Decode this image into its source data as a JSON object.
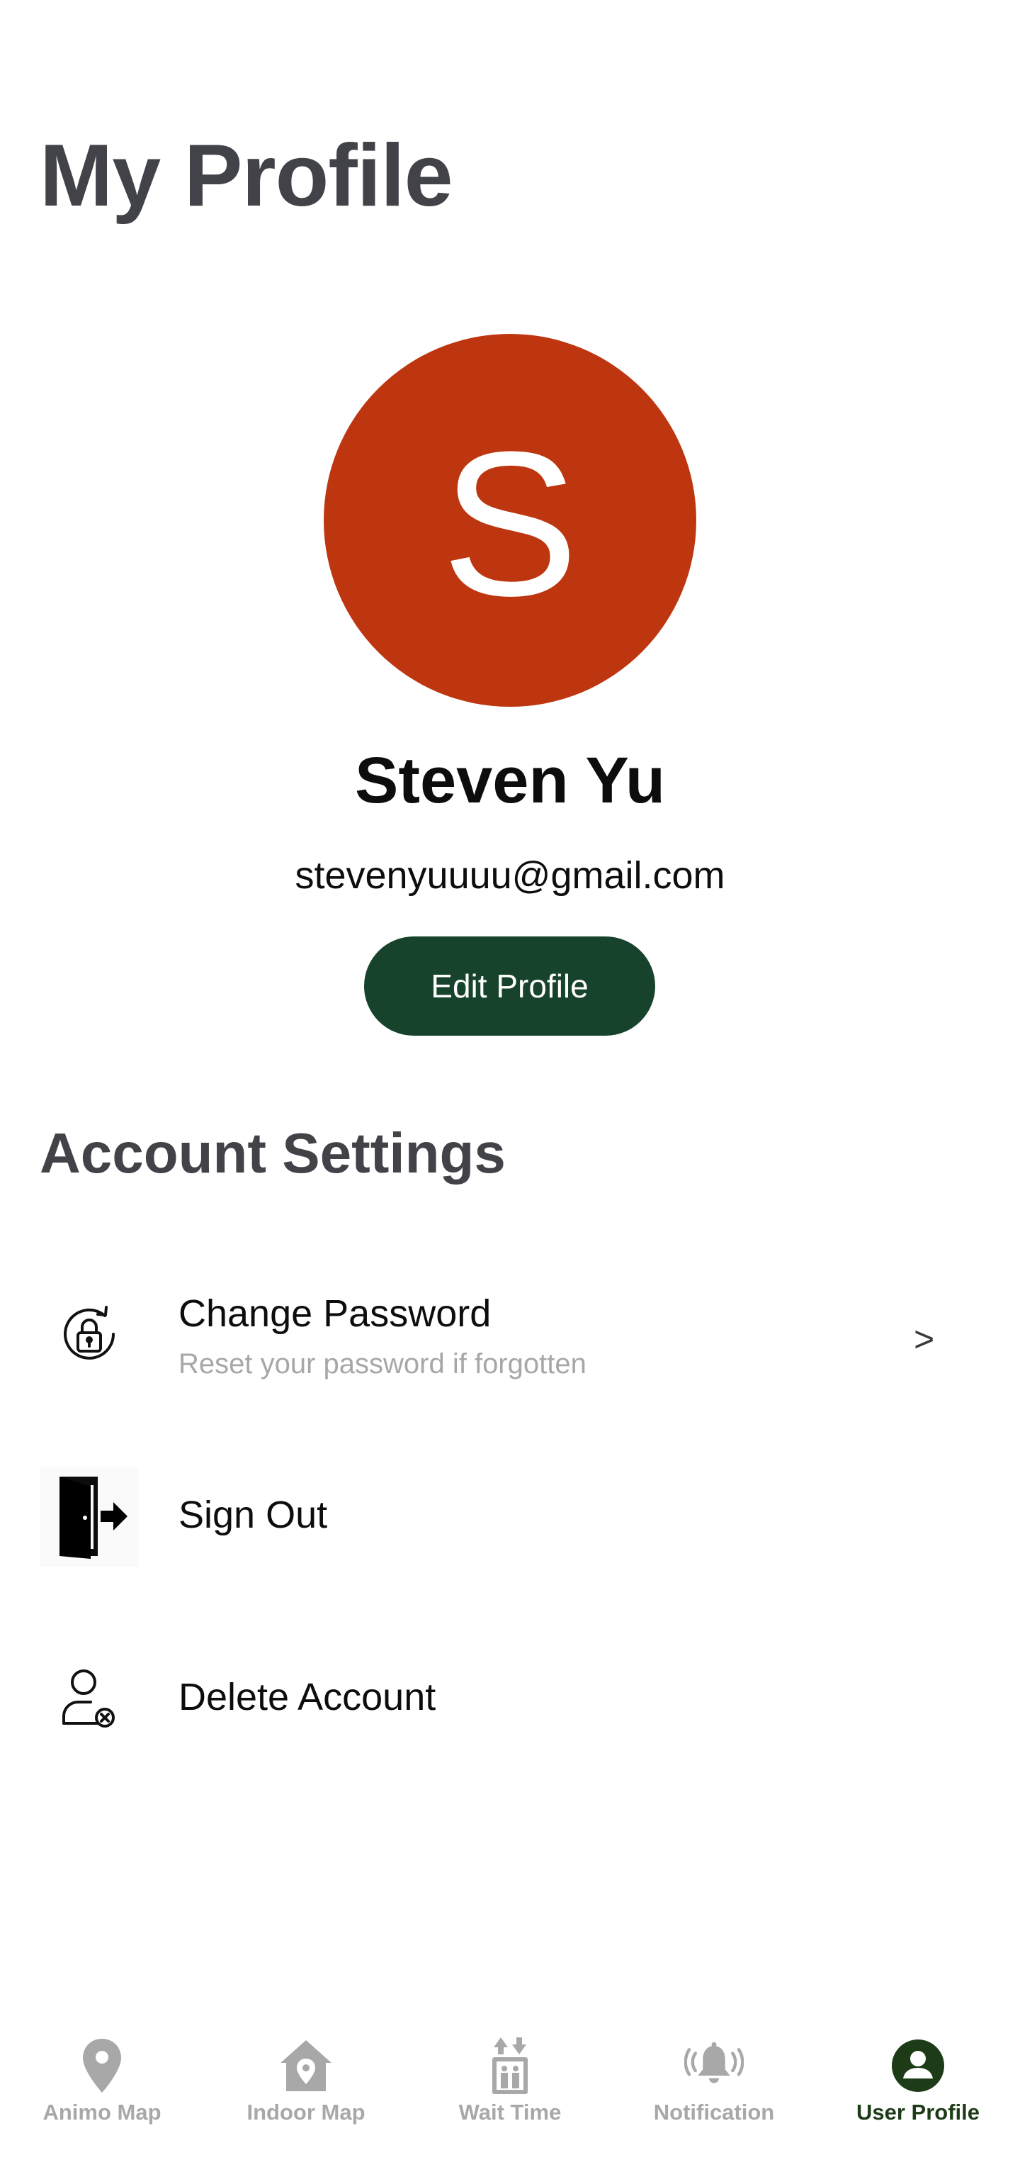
{
  "header": {
    "title": "My Profile"
  },
  "profile": {
    "avatar_letter": "S",
    "avatar_color": "#bd360f",
    "name": "Steven Yu",
    "email": "stevenyuuuu@gmail.com",
    "edit_button_label": "Edit Profile",
    "edit_button_color": "#17432c"
  },
  "account_settings": {
    "title": "Account Settings",
    "items": [
      {
        "label": "Change Password",
        "subtitle": "Reset your password if forgotten",
        "icon": "lock-refresh-icon",
        "chevron": ">"
      },
      {
        "label": "Sign Out",
        "icon": "door-exit-icon"
      },
      {
        "label": "Delete Account",
        "icon": "user-remove-icon"
      }
    ]
  },
  "bottom_nav": {
    "active_color": "#1d3b16",
    "inactive_color": "#a8a8a8",
    "items": [
      {
        "label": "Animo Map",
        "icon": "map-pin-icon",
        "active": false
      },
      {
        "label": "Indoor Map",
        "icon": "house-pin-icon",
        "active": false
      },
      {
        "label": "Wait Time",
        "icon": "elevator-icon",
        "active": false
      },
      {
        "label": "Notification",
        "icon": "bell-ringing-icon",
        "active": false
      },
      {
        "label": "User Profile",
        "icon": "user-circle-icon",
        "active": true
      }
    ]
  }
}
